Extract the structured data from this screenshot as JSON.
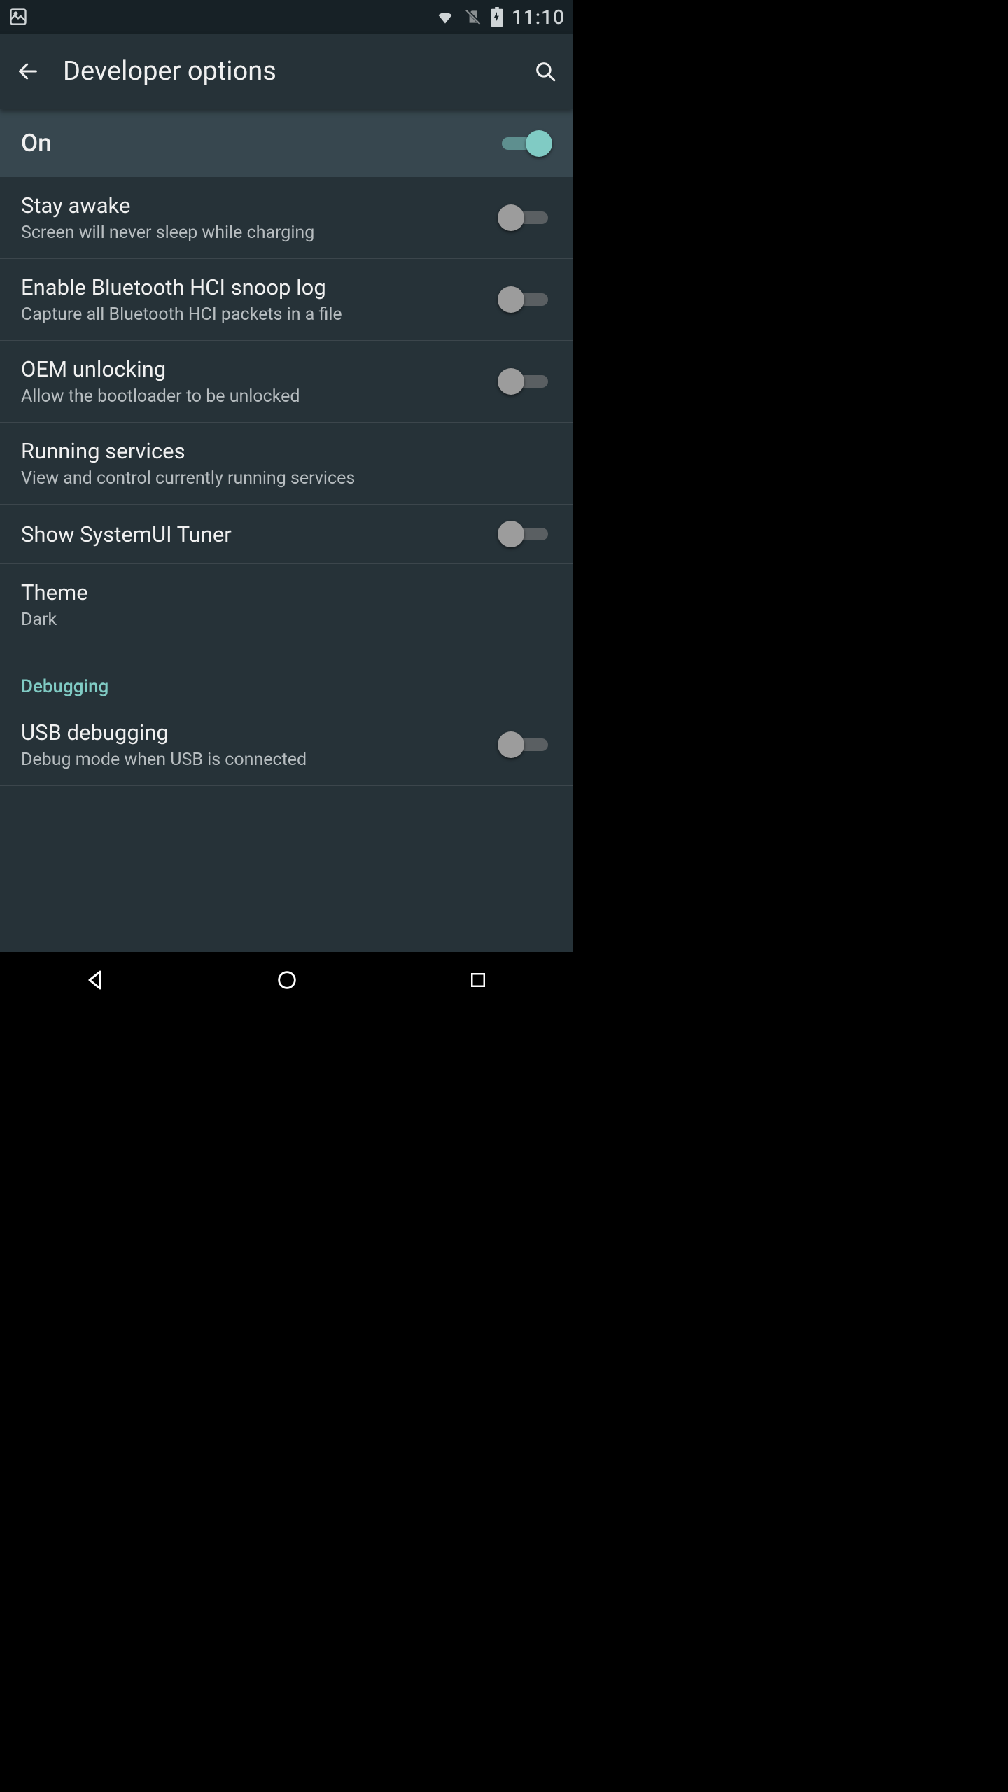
{
  "status_bar": {
    "time": "11:10"
  },
  "app_bar": {
    "title": "Developer options"
  },
  "master_switch": {
    "label": "On",
    "state": "on"
  },
  "items": {
    "stay_awake": {
      "title": "Stay awake",
      "sub": "Screen will never sleep while charging"
    },
    "hci": {
      "title": "Enable Bluetooth HCI snoop log",
      "sub": "Capture all Bluetooth HCI packets in a file"
    },
    "oem": {
      "title": "OEM unlocking",
      "sub": "Allow the bootloader to be unlocked"
    },
    "running": {
      "title": "Running services",
      "sub": "View and control currently running services"
    },
    "sysui": {
      "title": "Show SystemUI Tuner"
    },
    "theme": {
      "title": "Theme",
      "sub": "Dark"
    },
    "usb_debug": {
      "title": "USB debugging",
      "sub": "Debug mode when USB is connected"
    }
  },
  "sections": {
    "debugging": "Debugging"
  }
}
